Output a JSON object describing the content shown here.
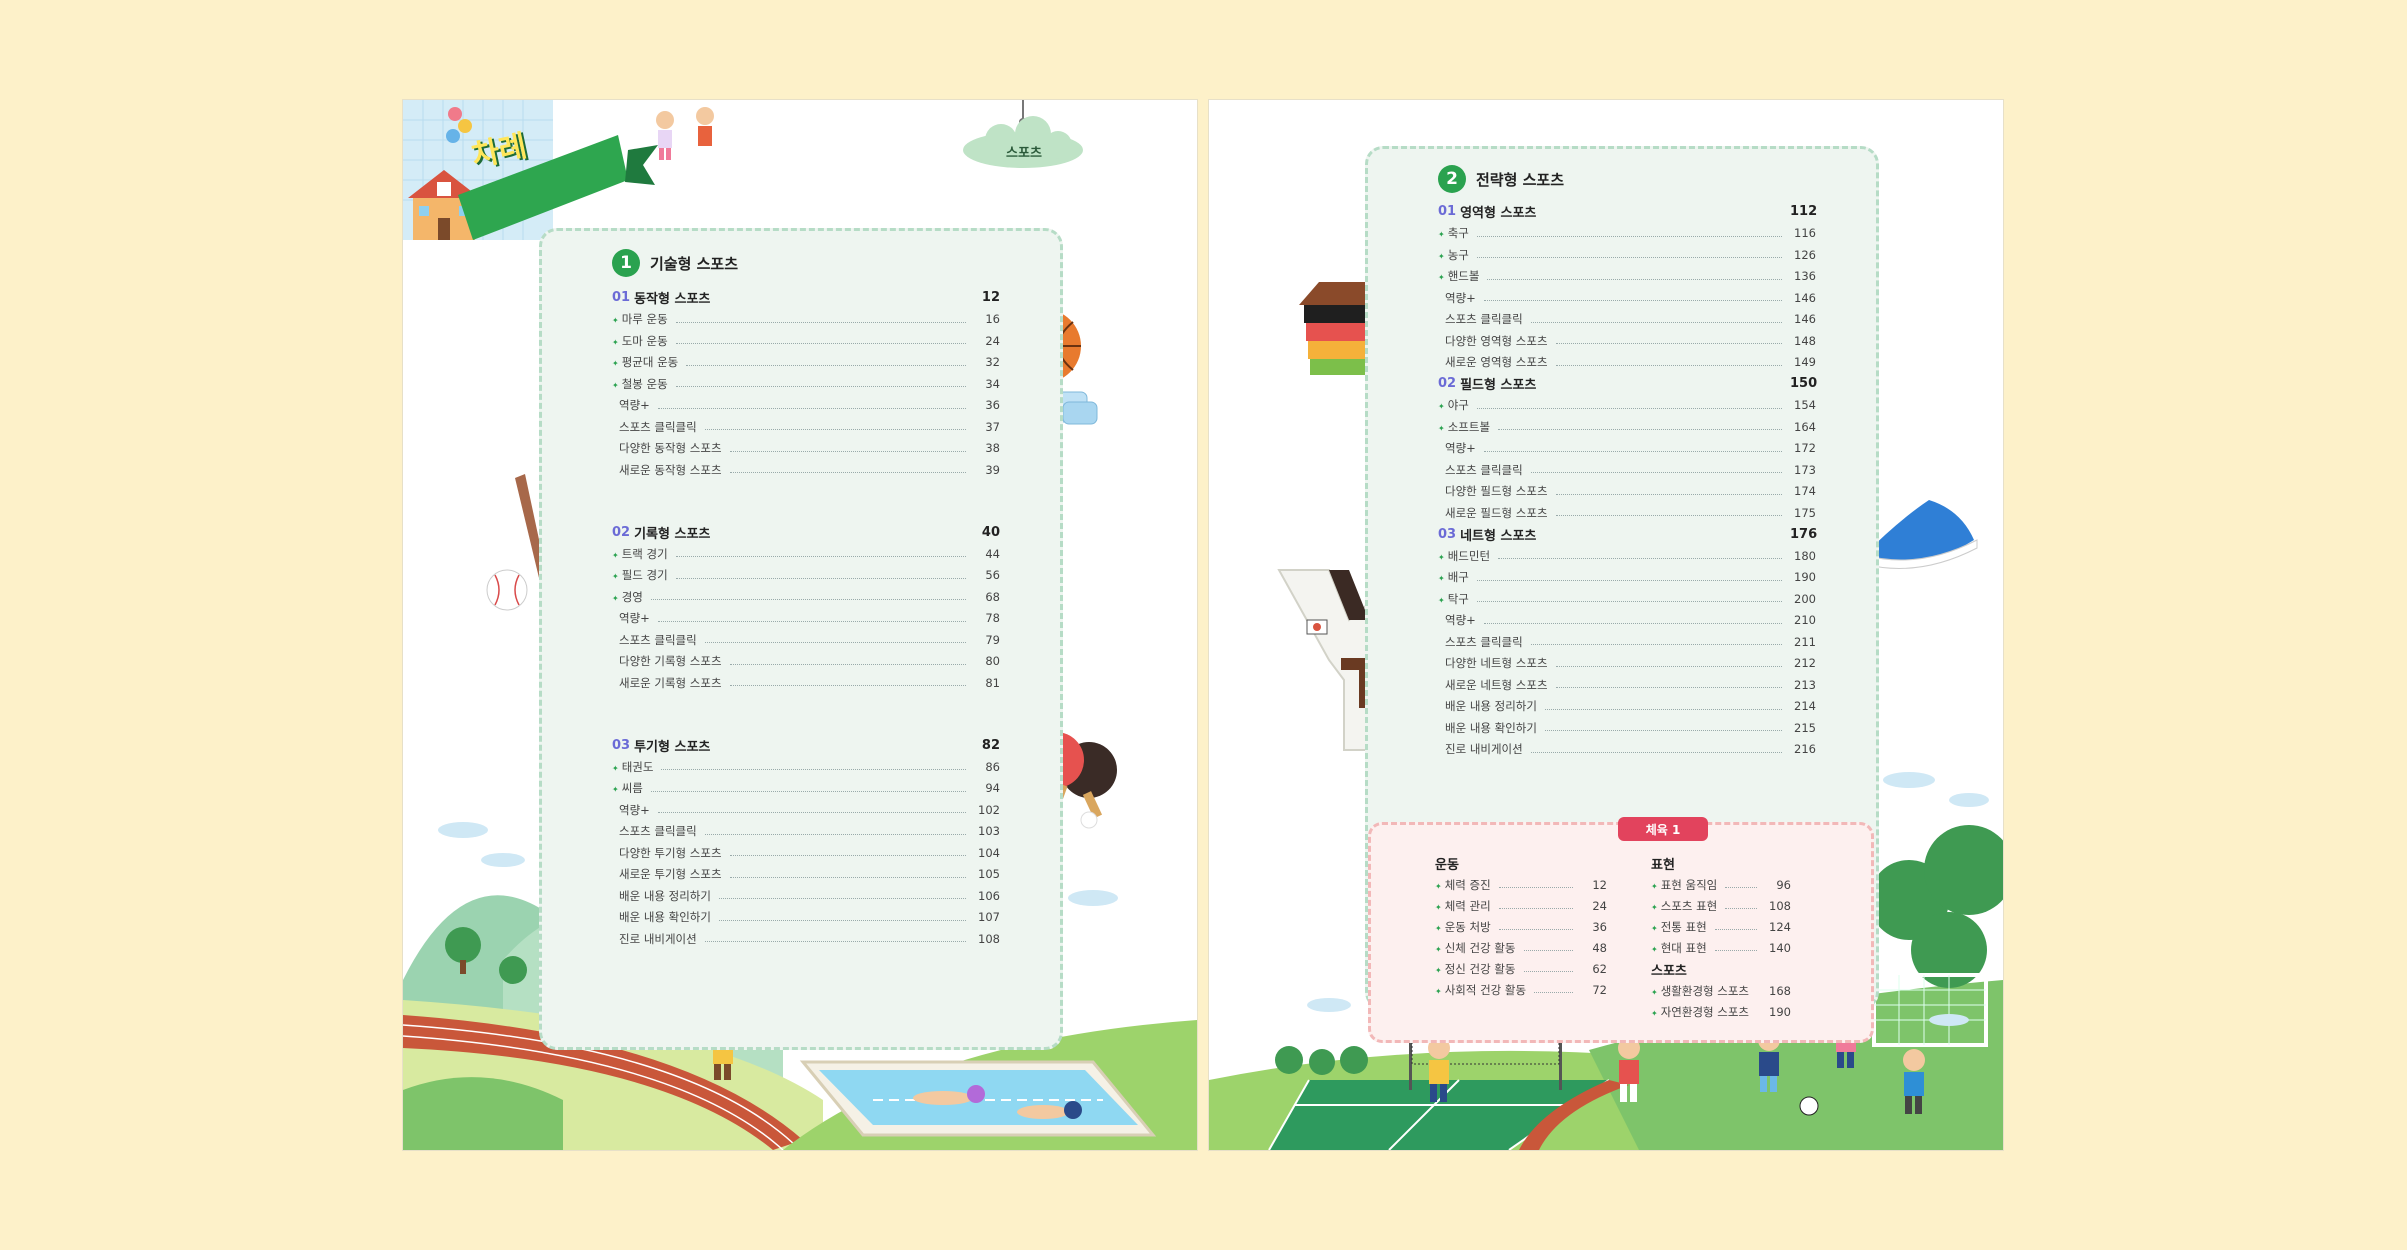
{
  "left_page": {
    "ribbon_title": "차례",
    "cloud_tag": "스포츠",
    "section_number": "1",
    "section_title": "기술형 스포츠",
    "groups": [
      {
        "num": "01",
        "title": "동작형 스포츠",
        "page": "12",
        "items": [
          {
            "label": "마루 운동",
            "page": "16",
            "bullet": true
          },
          {
            "label": "도마 운동",
            "page": "24",
            "bullet": true
          },
          {
            "label": "평균대 운동",
            "page": "32",
            "bullet": true
          },
          {
            "label": "철봉 운동",
            "page": "34",
            "bullet": true
          },
          {
            "label": "역량+",
            "page": "36",
            "bullet": false
          },
          {
            "label": "스포츠 클릭클릭",
            "page": "37",
            "bullet": false
          },
          {
            "label": "다양한 동작형 스포츠",
            "page": "38",
            "bullet": false
          },
          {
            "label": "새로운 동작형 스포츠",
            "page": "39",
            "bullet": false
          }
        ]
      },
      {
        "num": "02",
        "title": "기록형 스포츠",
        "page": "40",
        "items": [
          {
            "label": "트랙 경기",
            "page": "44",
            "bullet": true
          },
          {
            "label": "필드 경기",
            "page": "56",
            "bullet": true
          },
          {
            "label": "경영",
            "page": "68",
            "bullet": true
          },
          {
            "label": "역량+",
            "page": "78",
            "bullet": false
          },
          {
            "label": "스포츠 클릭클릭",
            "page": "79",
            "bullet": false
          },
          {
            "label": "다양한 기록형 스포츠",
            "page": "80",
            "bullet": false
          },
          {
            "label": "새로운 기록형 스포츠",
            "page": "81",
            "bullet": false
          }
        ]
      },
      {
        "num": "03",
        "title": "투기형 스포츠",
        "page": "82",
        "items": [
          {
            "label": "태권도",
            "page": "86",
            "bullet": true
          },
          {
            "label": "씨름",
            "page": "94",
            "bullet": true
          },
          {
            "label": "역량+",
            "page": "102",
            "bullet": false
          },
          {
            "label": "스포츠 클릭클릭",
            "page": "103",
            "bullet": false
          },
          {
            "label": "다양한 투기형 스포츠",
            "page": "104",
            "bullet": false
          },
          {
            "label": "새로운 투기형 스포츠",
            "page": "105",
            "bullet": false
          },
          {
            "label": "배운 내용 정리하기",
            "page": "106",
            "bullet": false
          },
          {
            "label": "배운 내용 확인하기",
            "page": "107",
            "bullet": false
          },
          {
            "label": "진로 내비게이션",
            "page": "108",
            "bullet": false
          }
        ]
      }
    ]
  },
  "right_page": {
    "section_number": "2",
    "section_title": "전략형 스포츠",
    "groups": [
      {
        "num": "01",
        "title": "영역형 스포츠",
        "page": "112",
        "items": [
          {
            "label": "축구",
            "page": "116",
            "bullet": true
          },
          {
            "label": "농구",
            "page": "126",
            "bullet": true
          },
          {
            "label": "핸드볼",
            "page": "136",
            "bullet": true
          },
          {
            "label": "역량+",
            "page": "146",
            "bullet": false
          },
          {
            "label": "스포츠 클릭클릭",
            "page": "146",
            "bullet": false
          },
          {
            "label": "다양한 영역형 스포츠",
            "page": "148",
            "bullet": false
          },
          {
            "label": "새로운 영역형 스포츠",
            "page": "149",
            "bullet": false
          }
        ]
      },
      {
        "num": "02",
        "title": "필드형 스포츠",
        "page": "150",
        "items": [
          {
            "label": "야구",
            "page": "154",
            "bullet": true
          },
          {
            "label": "소프트볼",
            "page": "164",
            "bullet": true
          },
          {
            "label": "역량+",
            "page": "172",
            "bullet": false
          },
          {
            "label": "스포츠 클릭클릭",
            "page": "173",
            "bullet": false
          },
          {
            "label": "다양한 필드형 스포츠",
            "page": "174",
            "bullet": false
          },
          {
            "label": "새로운 필드형 스포츠",
            "page": "175",
            "bullet": false
          }
        ]
      },
      {
        "num": "03",
        "title": "네트형 스포츠",
        "page": "176",
        "items": [
          {
            "label": "배드민턴",
            "page": "180",
            "bullet": true
          },
          {
            "label": "배구",
            "page": "190",
            "bullet": true
          },
          {
            "label": "탁구",
            "page": "200",
            "bullet": true
          },
          {
            "label": "역량+",
            "page": "210",
            "bullet": false
          },
          {
            "label": "스포츠 클릭클릭",
            "page": "211",
            "bullet": false
          },
          {
            "label": "다양한 네트형 스포츠",
            "page": "212",
            "bullet": false
          },
          {
            "label": "새로운 네트형 스포츠",
            "page": "213",
            "bullet": false
          },
          {
            "label": "배운 내용 정리하기",
            "page": "214",
            "bullet": false
          },
          {
            "label": "배운 내용 확인하기",
            "page": "215",
            "bullet": false
          },
          {
            "label": "진로 내비게이션",
            "page": "216",
            "bullet": false
          }
        ]
      }
    ],
    "pink_box": {
      "tag": "체육 1",
      "col1": {
        "heading": "운동",
        "items": [
          {
            "label": "체력 증진",
            "page": "12"
          },
          {
            "label": "체력 관리",
            "page": "24"
          },
          {
            "label": "운동 처방",
            "page": "36"
          },
          {
            "label": "신체 건강 활동",
            "page": "48"
          },
          {
            "label": "정신 건강 활동",
            "page": "62"
          },
          {
            "label": "사회적 건강 활동",
            "page": "72"
          }
        ]
      },
      "col2": {
        "heading": "표현",
        "items": [
          {
            "label": "표현 움직임",
            "page": "96"
          },
          {
            "label": "스포츠 표현",
            "page": "108"
          },
          {
            "label": "전통 표현",
            "page": "124"
          },
          {
            "label": "현대 표현",
            "page": "140"
          }
        ],
        "heading2": "스포츠",
        "items2": [
          {
            "label": "생활환경형 스포츠",
            "page": "168"
          },
          {
            "label": "자연환경형 스포츠",
            "page": "190"
          }
        ]
      }
    }
  },
  "colors": {
    "background": "#fdf1c9",
    "accent_green": "#2aa24f",
    "section_num_purple": "#6b6bd6",
    "box_fill": "#eef5f0",
    "pink_box_fill": "#fdf0ef",
    "pink_tag": "#e2435d"
  }
}
